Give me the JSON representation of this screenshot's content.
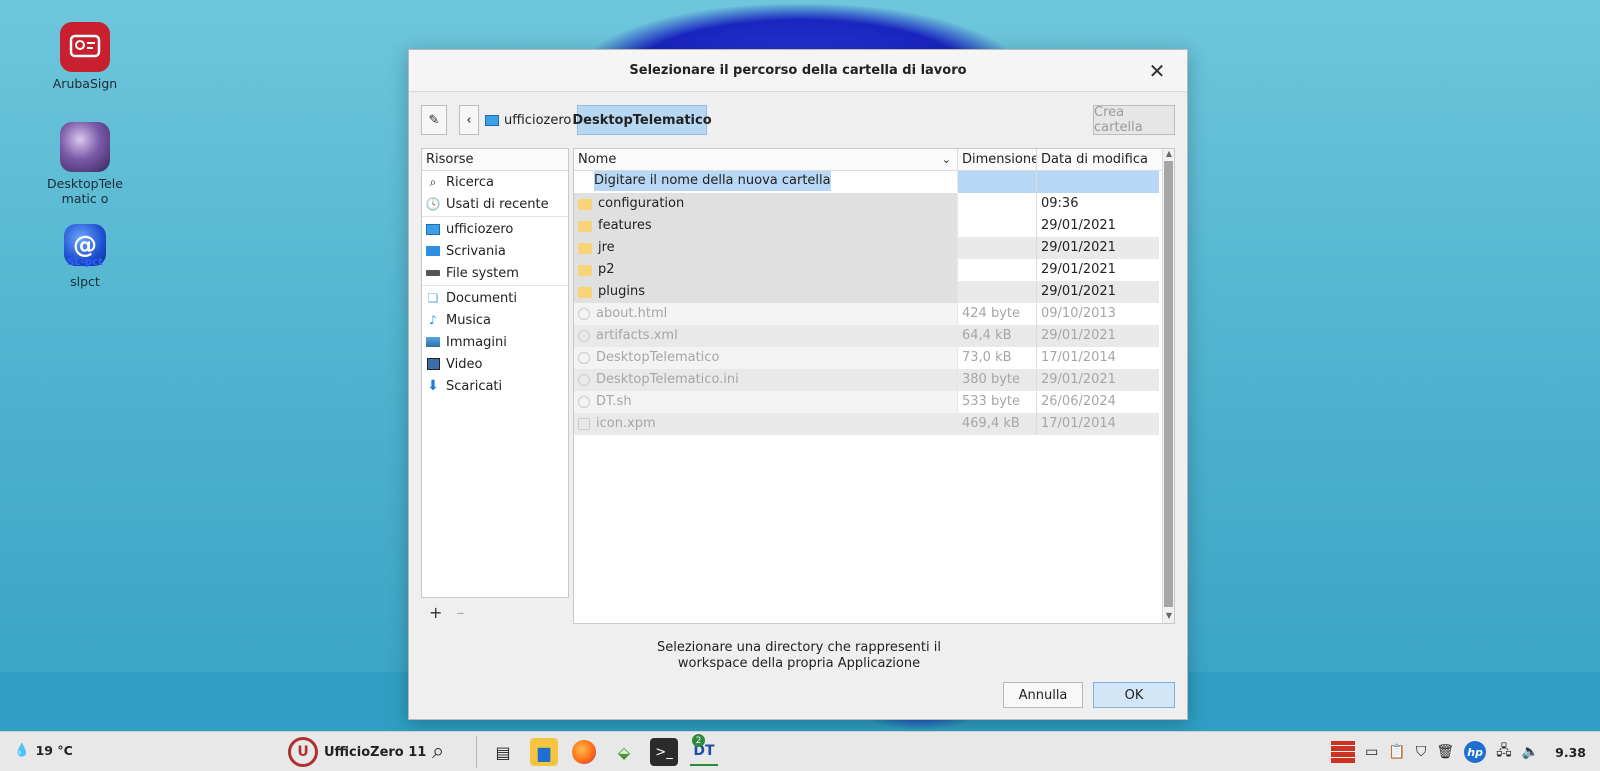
{
  "desktop": {
    "icons": [
      {
        "label": "ArubaSign"
      },
      {
        "label": "DesktopTelematic o"
      },
      {
        "label": "slpct",
        "overlay": "SL-pct"
      }
    ]
  },
  "dialog": {
    "title": "Selezionare il percorso della cartella di lavoro",
    "breadcrumb": {
      "home": "ufficiozero",
      "current": "DesktopTelematico"
    },
    "create_folder_label": "Crea cartella",
    "places": {
      "header": "Risorse",
      "items": [
        {
          "label": "Ricerca",
          "icon": "search-icon"
        },
        {
          "label": "Usati di recente",
          "icon": "recent-icon"
        },
        {
          "label": "ufficiozero",
          "icon": "computer-icon"
        },
        {
          "label": "Scrivania",
          "icon": "desktop-icon"
        },
        {
          "label": "File system",
          "icon": "drive-icon"
        },
        {
          "label": "Documenti",
          "icon": "documents-icon"
        },
        {
          "label": "Musica",
          "icon": "music-icon"
        },
        {
          "label": "Immagini",
          "icon": "images-icon"
        },
        {
          "label": "Video",
          "icon": "video-icon"
        },
        {
          "label": "Scaricati",
          "icon": "download-icon"
        }
      ],
      "add_label": "+",
      "remove_label": "–"
    },
    "files": {
      "columns": {
        "name": "Nome",
        "size": "Dimensione",
        "date": "Data di modifica"
      },
      "new_folder_placeholder": "Digitare il nome della nuova cartella",
      "rows": [
        {
          "name": "configuration",
          "size": "",
          "date": "09:36"
        },
        {
          "name": "features",
          "size": "",
          "date": "29/01/2021"
        },
        {
          "name": "jre",
          "size": "",
          "date": "29/01/2021"
        },
        {
          "name": "p2",
          "size": "",
          "date": "29/01/2021"
        },
        {
          "name": "plugins",
          "size": "",
          "date": "29/01/2021"
        },
        {
          "name": "about.html",
          "size": "424 byte",
          "date": "09/10/2013"
        },
        {
          "name": "artifacts.xml",
          "size": "64,4 kB",
          "date": "29/01/2021"
        },
        {
          "name": "DesktopTelematico",
          "size": "73,0 kB",
          "date": "17/01/2014"
        },
        {
          "name": "DesktopTelematico.ini",
          "size": "380 byte",
          "date": "29/01/2021"
        },
        {
          "name": "DT.sh",
          "size": "533 byte",
          "date": "26/06/2024"
        },
        {
          "name": "icon.xpm",
          "size": "469,4 kB",
          "date": "17/01/2014"
        }
      ]
    },
    "message_line1": "Selezionare una directory che rappresenti il",
    "message_line2": "workspace della propria Applicazione",
    "cancel_label": "Annulla",
    "ok_label": "OK"
  },
  "taskbar": {
    "weather": "19 °C",
    "start_label": "UfficioZero 11",
    "badge": "2",
    "dt_label": "DT",
    "clock": "9.38"
  }
}
